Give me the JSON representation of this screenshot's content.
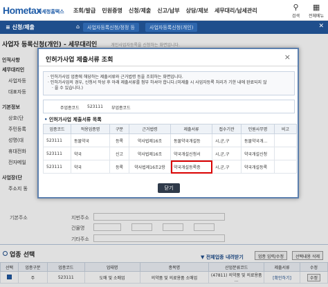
{
  "header": {
    "logo_text": "Hometax",
    "logo_sub": "국세청홈택스",
    "logo_tiny": "",
    "nav": [
      "조회/발급",
      "민원증명",
      "신청/제출",
      "신고/납부",
      "상담/제보",
      "세무대리/납세관리"
    ],
    "search_label": "검색",
    "all_menu_label": "전체메뉴"
  },
  "subbar": {
    "menu_label": "신청/제출",
    "tab1": "사업자등록신청/정정 등",
    "tab2": "사업자등록신청(개인)"
  },
  "page": {
    "title": "사업자 등록신청(개인) - 세무대리인",
    "desc": "개인사업자등록을 신청하는 화면입니다."
  },
  "background": {
    "left_rows": [
      "인적사항",
      "세무대리인",
      "사업자등",
      "대표자등",
      "기본정보",
      "상호(단",
      "주민등록",
      "성명(대",
      "휴대전화",
      "전자메일",
      "사업장(단",
      "주소지 동"
    ],
    "address_label": "기본주소",
    "addr_fields": [
      "지번주소",
      "건물명",
      "기타주소"
    ],
    "section_title": "업종 선택",
    "toggle_link": "전체업종 내려받기",
    "btn_edit": "업종 입력/수정",
    "btn_delete": "선택내용 삭제",
    "table_headers": [
      "선택",
      "업종구분",
      "업종코드",
      "업태명",
      "종목명",
      "산업분류코드",
      "제출서류",
      "수정"
    ],
    "table_row": [
      "",
      "주",
      "523111",
      "도매 및 소매업",
      "의약품 및 의료용품 소매업",
      "(47811) 의약품 및 의료용품 ...",
      "[확인하기]",
      "수정"
    ]
  },
  "modal": {
    "title": "인허가사업 제출서류 조회",
    "close_label": "×",
    "guide": [
      "인허가사업 업종에 해당하는 제출서류와 근거법령 등을 조회하는 화면입니다.",
      "인허가사업의 경우, 신청서 작성 후 아래 제출서류를 첨부 하셔야 합니다.(미제출 시 사업자등록 처리가 기한 내에 완료되지 않",
      "을 수 있습니다.)"
    ],
    "code_label": "주업종코드",
    "code_value": "523111",
    "type_label": "부업종코드",
    "list_title": "인허가사업 제출서류 목록",
    "headers": [
      "업종코드",
      "적용업종명",
      "구분",
      "근거법령",
      "제출서류",
      "접수기관",
      "민원사무명",
      "비고"
    ],
    "rows": [
      [
        "523111",
        "동물약국",
        "등록",
        "약사법제16조",
        "동물약국개설등",
        "시,군,구",
        "동물약국개...",
        ""
      ],
      [
        "523111",
        "약국",
        "신고",
        "약사법제16조",
        "약국개설신청서",
        "시,군,구",
        "약국개설신청",
        ""
      ],
      [
        "523111",
        "약국",
        "등록",
        "약사법제16조2항",
        "약국개설등록증",
        "시,군,구",
        "약국개설등록",
        ""
      ]
    ],
    "confirm_label": "닫기"
  }
}
